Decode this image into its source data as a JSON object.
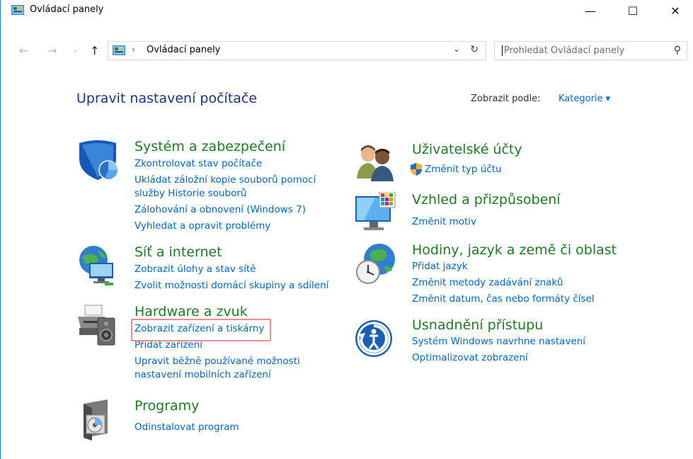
{
  "window": {
    "title": "Ovládací panely",
    "minimize_glyph": "—",
    "maximize_glyph": "☐",
    "close_glyph": "✕"
  },
  "addressbar": {
    "breadcrumb": "Ovládací panely",
    "separator": "›",
    "search_placeholder": "Prohledat Ovládací panely"
  },
  "header": {
    "title": "Upravit nastavení počítače",
    "view_by_label": "Zobrazit podle:",
    "view_by_value": "Kategorie ▾"
  },
  "categories": {
    "system": {
      "title": "Systém a zabezpečení",
      "links": [
        "Zkontrolovat stav počítače",
        "Ukládat záložní kopie souborů pomocí",
        "služby Historie souborů",
        "Zálohování a obnovení (Windows 7)",
        "Vyhledat a opravit problémy"
      ]
    },
    "network": {
      "title": "Síť a internet",
      "links": [
        "Zobrazit úlohy a stav sítě",
        "Zvolit možnosti domácí skupiny a sdílení"
      ]
    },
    "hardware": {
      "title": "Hardware a zvuk",
      "links": [
        "Zobrazit zařízení a tiskárny",
        "Přidat zařízení",
        "Upravit běžně používané možnosti",
        "nastavení mobilních zařízení"
      ]
    },
    "programs": {
      "title": "Programy",
      "links": [
        "Odinstalovat program"
      ]
    },
    "users": {
      "title": "Uživatelské účty",
      "links": [
        "Změnit typ účtu"
      ]
    },
    "appearance": {
      "title": "Vzhled a přizpůsobení",
      "links": [
        "Změnit motiv"
      ]
    },
    "clock": {
      "title": "Hodiny, jazyk a země či oblast",
      "links": [
        "Přidat jazyk",
        "Změnit metody zadávání znaků",
        "Změnit datum, čas nebo formáty čísel"
      ]
    },
    "access": {
      "title": "Usnadnění přístupu",
      "links": [
        "Systém Windows navrhne nastavení",
        "Optimalizovat zobrazení"
      ]
    }
  },
  "colors": {
    "heading": "#1e3287",
    "category_title": "#1f7a26",
    "link": "#0066cc",
    "highlight": "#ec8f95"
  }
}
